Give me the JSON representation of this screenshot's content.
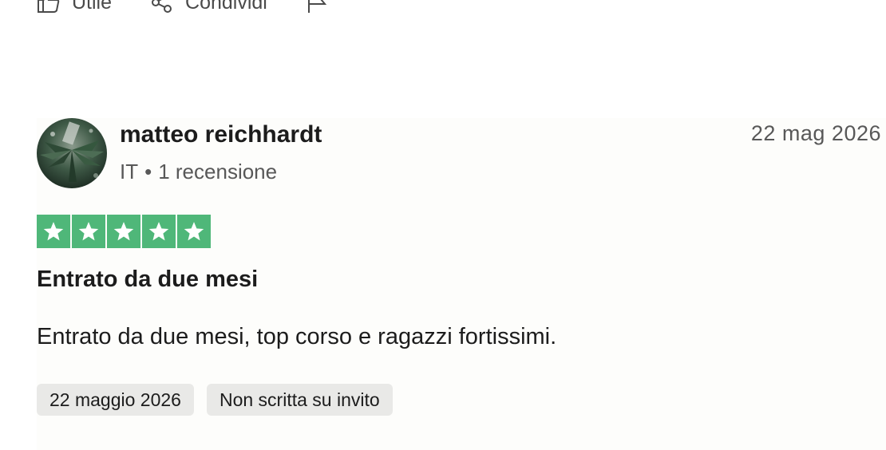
{
  "actions": {
    "useful_label": "Utile",
    "share_label": "Condividi",
    "icons": [
      "thumbs-up-icon",
      "share-icon",
      "flag-icon"
    ]
  },
  "review": {
    "reviewer": {
      "name": "matteo reichhardt",
      "country": "IT",
      "separator": "•",
      "review_count": "1 recensione"
    },
    "date": "22 mag 2026",
    "rating": 5,
    "rating_color": "#4fb779",
    "title": "Entrato da due mesi",
    "body": "Entrato da due mesi, top corso e ragazzi fortissimi.",
    "tags": {
      "experience_date": "22 maggio 2026",
      "invite_status": "Non scritta su invito"
    }
  }
}
